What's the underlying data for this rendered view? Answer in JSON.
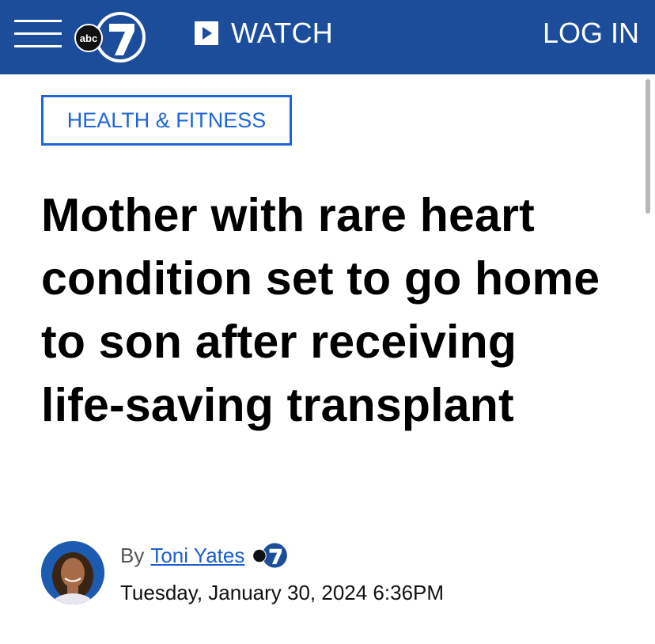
{
  "header": {
    "watch_label": "WATCH",
    "login_label": "LOG IN",
    "logo_text": "abc",
    "logo_number": "7"
  },
  "article": {
    "category": "HEALTH & FITNESS",
    "headline": "Mother with rare heart condition set to go home to son after receiving life-saving transplant",
    "byline_prefix": "By",
    "author": "Toni Yates",
    "date": "Tuesday, January 30, 2024 6:36PM"
  },
  "colors": {
    "header_bg": "#1b4d9b",
    "link_blue": "#1e66d8"
  },
  "icons": [
    "menu-icon",
    "play-icon",
    "abc7-logo"
  ]
}
